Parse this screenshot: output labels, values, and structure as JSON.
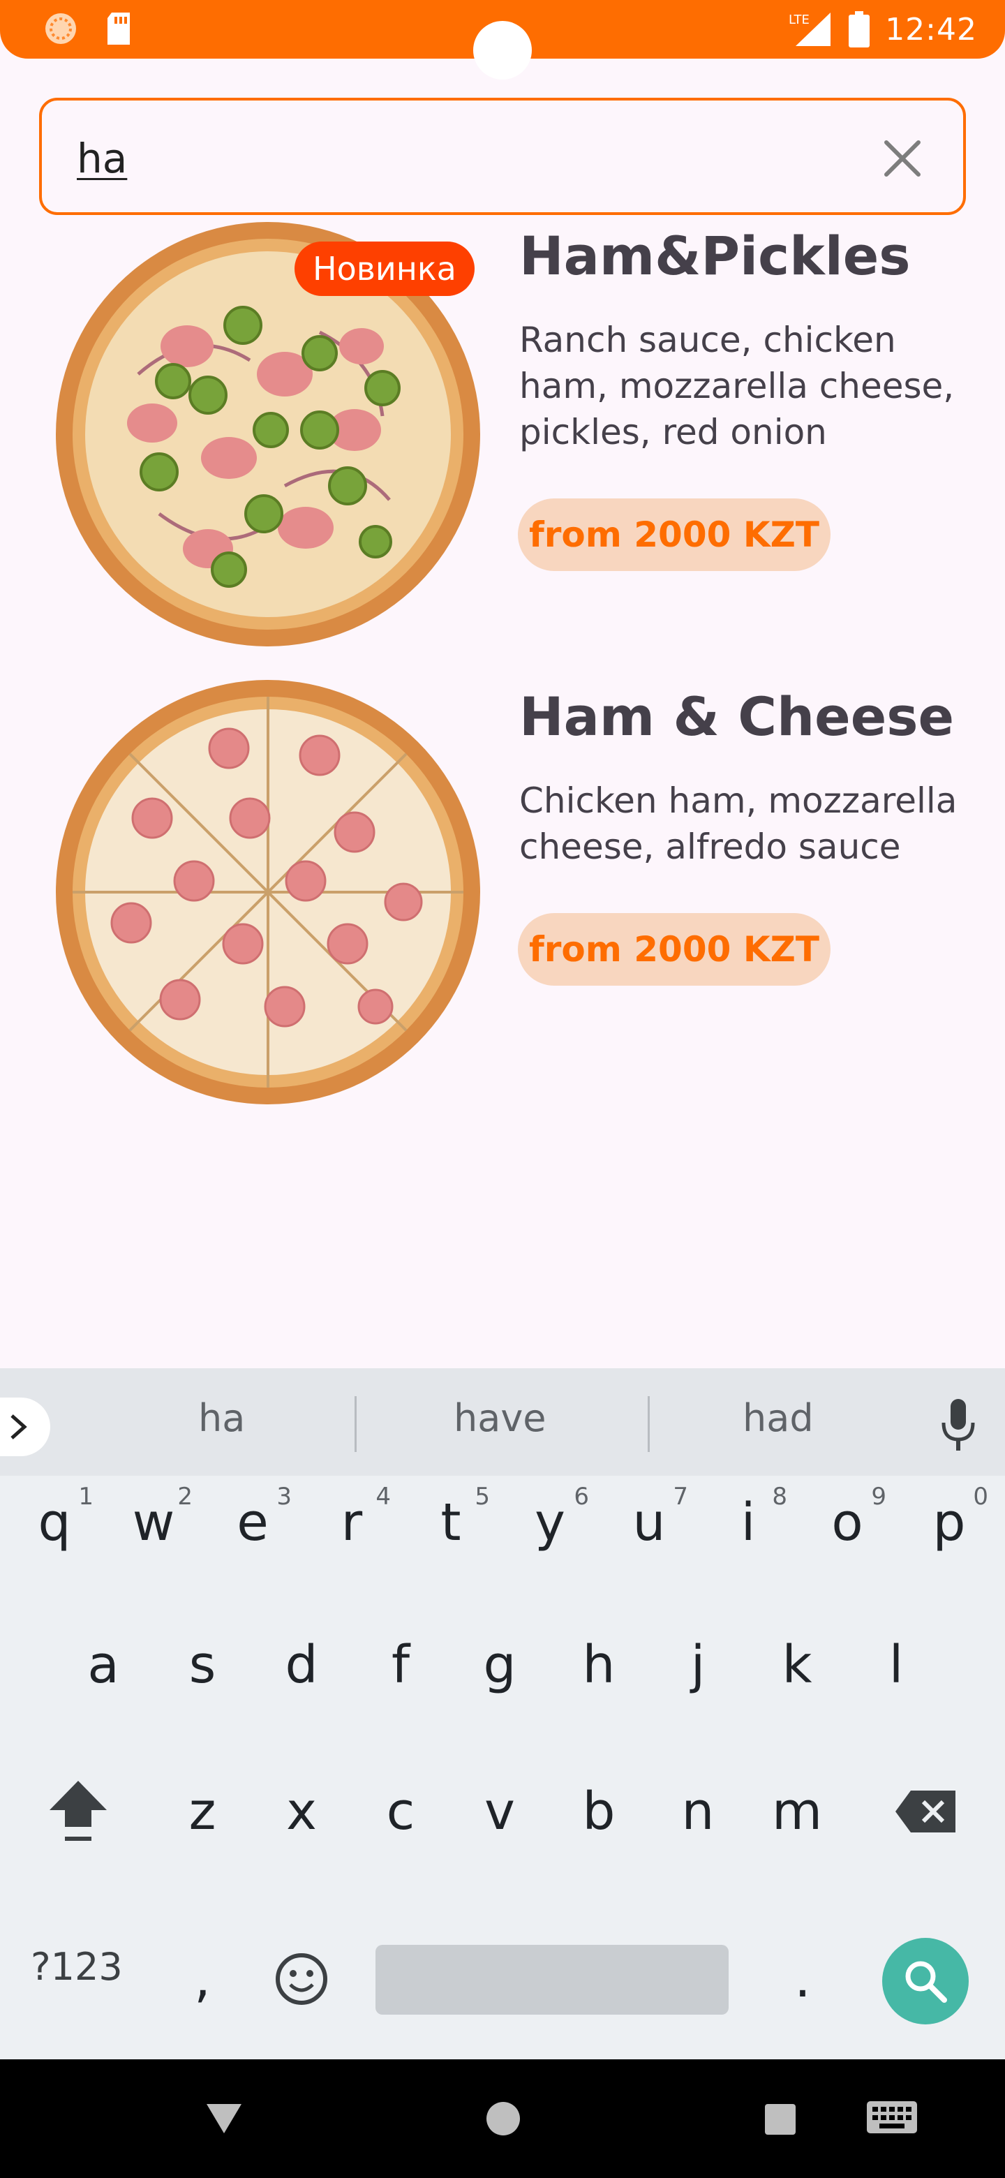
{
  "status_bar": {
    "time": "12:42",
    "network": "LTE",
    "icons": [
      "orange-app-icon",
      "sd-card-icon",
      "lte-signal-icon",
      "battery-icon"
    ]
  },
  "search": {
    "value": "ha",
    "clear_icon": "close-icon"
  },
  "results": [
    {
      "name": "Ham&Pickles",
      "description": "Ranch sauce, chicken ham, mozzarella cheese, pickles, red onion",
      "price": "from 2000 KZT",
      "badge": "Новинка"
    },
    {
      "name": "Ham & Cheese",
      "description": "Chicken ham, mozzarella cheese, alfredo sauce",
      "price": "from 2000 KZT"
    }
  ],
  "keyboard": {
    "suggestions": [
      "ha",
      "have",
      "had"
    ],
    "row1": [
      {
        "key": "q",
        "hint": "1"
      },
      {
        "key": "w",
        "hint": "2"
      },
      {
        "key": "e",
        "hint": "3"
      },
      {
        "key": "r",
        "hint": "4"
      },
      {
        "key": "t",
        "hint": "5"
      },
      {
        "key": "y",
        "hint": "6"
      },
      {
        "key": "u",
        "hint": "7"
      },
      {
        "key": "i",
        "hint": "8"
      },
      {
        "key": "o",
        "hint": "9"
      },
      {
        "key": "p",
        "hint": "0"
      }
    ],
    "row2": [
      "a",
      "s",
      "d",
      "f",
      "g",
      "h",
      "j",
      "k",
      "l"
    ],
    "row3": [
      "z",
      "x",
      "c",
      "v",
      "b",
      "n",
      "m"
    ],
    "symbols_label": "?123",
    "comma": ",",
    "period": "."
  },
  "colors": {
    "accent": "#fe6d01",
    "badge": "#fe4000",
    "price_pill": "#f8d6bf",
    "keyboard_action": "#46b8a6"
  }
}
